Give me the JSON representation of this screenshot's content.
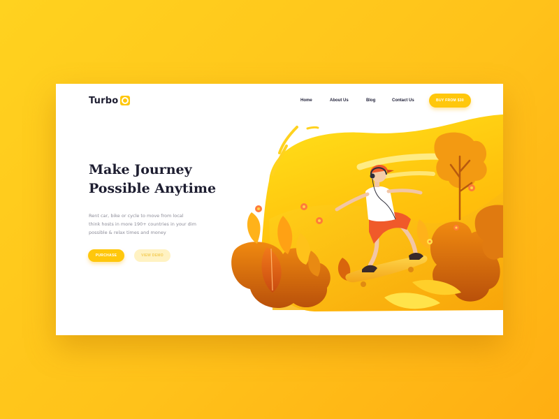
{
  "brand": {
    "name": "Turbo"
  },
  "nav": {
    "items": [
      {
        "label": "Home"
      },
      {
        "label": "About Us"
      },
      {
        "label": "Blog"
      },
      {
        "label": "Contact Us"
      }
    ],
    "cta_label": "BUY FROM $30"
  },
  "hero": {
    "title_line1": "Make Journey",
    "title_line2": "Possible Anytime",
    "desc_line1": "Rent car, bike or cycle to move from local",
    "desc_line2": "think hosts in more 190+ countries in your dim",
    "desc_line3": "possible & relax times and money",
    "purchase_label": "PURCHASE",
    "demo_label": "VIEW DEMO"
  },
  "colors": {
    "accent": "#ffc70c",
    "background": "#ffc21a",
    "heading": "#1d1d30",
    "body_text": "#8c8c98"
  },
  "illustration": {
    "subject": "skateboarder-among-autumn-plants"
  }
}
